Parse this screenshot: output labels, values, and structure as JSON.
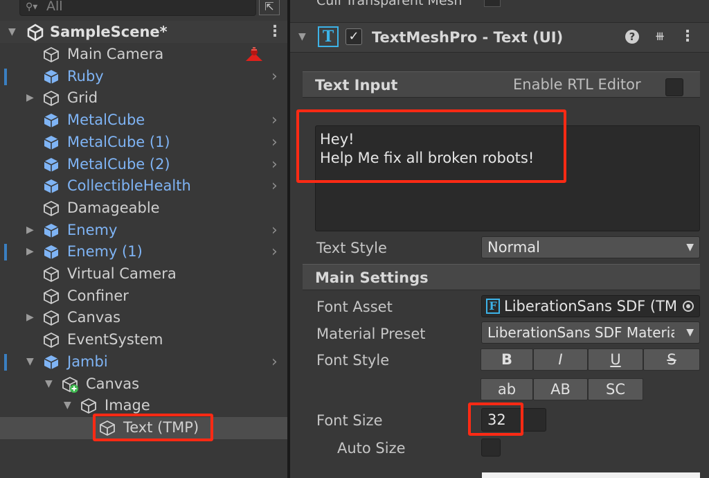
{
  "hierarchy": {
    "search": {
      "placeholder": "All"
    },
    "scene": {
      "name": "SampleScene*"
    },
    "items": [
      {
        "label": "Main Camera",
        "prefab": false,
        "depth": 0,
        "arrow": "none",
        "chevron": false,
        "modified": false
      },
      {
        "label": "Ruby",
        "prefab": true,
        "depth": 0,
        "arrow": "none",
        "chevron": true,
        "modified": true
      },
      {
        "label": "Grid",
        "prefab": false,
        "depth": 0,
        "arrow": "closed",
        "chevron": false,
        "modified": false
      },
      {
        "label": "MetalCube",
        "prefab": true,
        "depth": 0,
        "arrow": "none",
        "chevron": true,
        "modified": false
      },
      {
        "label": "MetalCube (1)",
        "prefab": true,
        "depth": 0,
        "arrow": "none",
        "chevron": true,
        "modified": false
      },
      {
        "label": "MetalCube (2)",
        "prefab": true,
        "depth": 0,
        "arrow": "none",
        "chevron": true,
        "modified": false
      },
      {
        "label": "CollectibleHealth",
        "prefab": true,
        "depth": 0,
        "arrow": "none",
        "chevron": true,
        "modified": false
      },
      {
        "label": "Damageable",
        "prefab": false,
        "depth": 0,
        "arrow": "none",
        "chevron": false,
        "modified": false
      },
      {
        "label": "Enemy",
        "prefab": true,
        "depth": 0,
        "arrow": "closed",
        "chevron": true,
        "modified": false
      },
      {
        "label": "Enemy (1)",
        "prefab": true,
        "depth": 0,
        "arrow": "closed",
        "chevron": true,
        "modified": true
      },
      {
        "label": "Virtual Camera",
        "prefab": false,
        "depth": 0,
        "arrow": "none",
        "chevron": false,
        "modified": false
      },
      {
        "label": "Confiner",
        "prefab": false,
        "depth": 0,
        "arrow": "none",
        "chevron": false,
        "modified": false
      },
      {
        "label": "Canvas",
        "prefab": false,
        "depth": 0,
        "arrow": "closed",
        "chevron": false,
        "modified": false
      },
      {
        "label": "EventSystem",
        "prefab": false,
        "depth": 0,
        "arrow": "none",
        "chevron": false,
        "modified": false
      },
      {
        "label": "Jambi",
        "prefab": true,
        "depth": 0,
        "arrow": "open",
        "chevron": true,
        "modified": true
      },
      {
        "label": "Canvas",
        "prefab": false,
        "depth": 1,
        "arrow": "open",
        "chevron": false,
        "modified": false,
        "added": true
      },
      {
        "label": "Image",
        "prefab": false,
        "depth": 2,
        "arrow": "open",
        "chevron": false,
        "modified": false
      },
      {
        "label": "Text (TMP)",
        "prefab": false,
        "depth": 3,
        "arrow": "none",
        "chevron": false,
        "modified": false,
        "selected": true
      }
    ]
  },
  "inspector": {
    "prev_component": "Cull Transparent Mesh",
    "component": {
      "title": "TextMeshPro - Text (UI)",
      "icon": "T",
      "enabled_mark": "✓"
    },
    "text_input": {
      "section": "Text Input",
      "rtl_label": "Enable RTL Editor"
    },
    "text": {
      "line1": "Hey!",
      "line2": "Help Me fix all broken robots!"
    },
    "text_style": {
      "label": "Text Style",
      "value": "Normal"
    },
    "main_settings": {
      "section": "Main Settings"
    },
    "font_asset": {
      "label": "Font Asset",
      "value": "LiberationSans SDF (TMP_Font Asset)",
      "icon": "F"
    },
    "material_preset": {
      "label": "Material Preset",
      "value": "LiberationSans SDF Material"
    },
    "font_style": {
      "label": "Font Style",
      "buttons": [
        "B",
        "I",
        "U",
        "S",
        "ab",
        "AB",
        "SC"
      ]
    },
    "font_size": {
      "label": "Font Size",
      "value": "32"
    },
    "auto_size": {
      "label": "Auto Size"
    }
  },
  "colors": {
    "highlight": "#ff2a14",
    "prefab_text": "#7fb4f5",
    "tmp_icon": "#3cb3e8"
  }
}
